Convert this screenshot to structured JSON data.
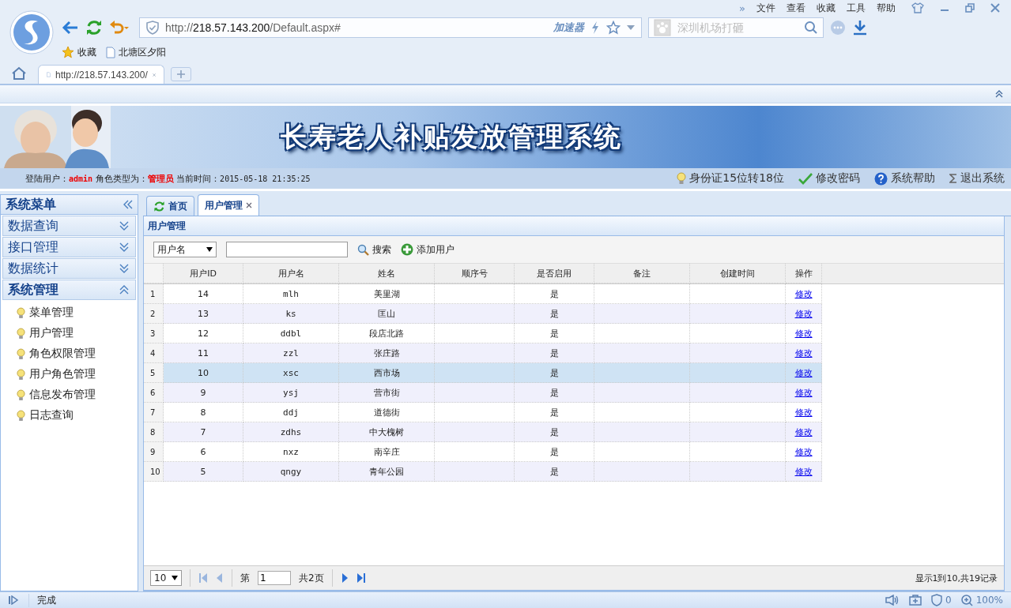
{
  "browser": {
    "more": "»",
    "menu": [
      "文件",
      "查看",
      "收藏",
      "工具",
      "帮助"
    ],
    "address": {
      "scheme": "http://",
      "host": "218.57.143.200",
      "path": "/Default.aspx#"
    },
    "accelerator": "加速器",
    "search": {
      "placeholder": "深圳机场打砸"
    },
    "bookmarks": [
      {
        "kind": "star",
        "label": "收藏"
      },
      {
        "kind": "page",
        "label": "北塘区夕阳"
      }
    ],
    "tabs": [
      {
        "label": "http://218.57.143.200/",
        "selected": true
      }
    ]
  },
  "banner": {
    "title": "长寿老人补贴发放管理系统"
  },
  "info": {
    "user_label": "登陆用户：",
    "user": "admin",
    "role_label": "角色类型为：",
    "role": "管理员",
    "time_label": "当前时间：",
    "time": "2015-05-18 21:35:25",
    "links": [
      {
        "kind": "bulb",
        "label": "身份证15位转18位"
      },
      {
        "kind": "check",
        "label": "修改密码"
      },
      {
        "kind": "help",
        "label": "系统帮助"
      },
      {
        "kind": "sigma",
        "label": "退出系统"
      }
    ]
  },
  "sidebar": {
    "title": "系统菜单",
    "groups": [
      {
        "label": "数据查询",
        "expanded": false
      },
      {
        "label": "接口管理",
        "expanded": false
      },
      {
        "label": "数据统计",
        "expanded": false
      },
      {
        "label": "系统管理",
        "expanded": true,
        "children": [
          "菜单管理",
          "用户管理",
          "角色权限管理",
          "用户角色管理",
          "信息发布管理",
          "日志查询"
        ]
      }
    ]
  },
  "tabs": [
    {
      "label": "首页",
      "selected": false,
      "closable": false
    },
    {
      "label": "用户管理",
      "selected": true,
      "closable": true
    }
  ],
  "panel_title": "用户管理",
  "toolbar": {
    "field": "用户名",
    "search": "搜索",
    "add": "添加用户"
  },
  "table": {
    "columns": [
      "用户ID",
      "用户名",
      "姓名",
      "顺序号",
      "是否启用",
      "备注",
      "创建时间",
      "操作"
    ],
    "rows": [
      {
        "n": "1",
        "cells": [
          "14",
          "mlh",
          "美里湖",
          "",
          "是",
          "",
          "",
          "修改"
        ],
        "selected": false
      },
      {
        "n": "2",
        "cells": [
          "13",
          "ks",
          "匡山",
          "",
          "是",
          "",
          "",
          "修改"
        ],
        "selected": false
      },
      {
        "n": "3",
        "cells": [
          "12",
          "ddbl",
          "段店北路",
          "",
          "是",
          "",
          "",
          "修改"
        ],
        "selected": false
      },
      {
        "n": "4",
        "cells": [
          "11",
          "zzl",
          "张庄路",
          "",
          "是",
          "",
          "",
          "修改"
        ],
        "selected": false
      },
      {
        "n": "5",
        "cells": [
          "10",
          "xsc",
          "西市场",
          "",
          "是",
          "",
          "",
          "修改"
        ],
        "selected": true
      },
      {
        "n": "6",
        "cells": [
          "9",
          "ysj",
          "营市街",
          "",
          "是",
          "",
          "",
          "修改"
        ],
        "selected": false
      },
      {
        "n": "7",
        "cells": [
          "8",
          "ddj",
          "道德街",
          "",
          "是",
          "",
          "",
          "修改"
        ],
        "selected": false
      },
      {
        "n": "8",
        "cells": [
          "7",
          "zdhs",
          "中大槐树",
          "",
          "是",
          "",
          "",
          "修改"
        ],
        "selected": false
      },
      {
        "n": "9",
        "cells": [
          "6",
          "nxz",
          "南辛庄",
          "",
          "是",
          "",
          "",
          "修改"
        ],
        "selected": false
      },
      {
        "n": "10",
        "cells": [
          "5",
          "qngy",
          "青年公园",
          "",
          "是",
          "",
          "",
          "修改"
        ],
        "selected": false
      }
    ]
  },
  "pager": {
    "page_size": "10",
    "page_label": "第",
    "page": "1",
    "total_pages": "共2页",
    "summary": "显示1到10,共19记录"
  },
  "status_bar": {
    "text": "完成",
    "ad_count": "0",
    "zoom": "100%"
  }
}
